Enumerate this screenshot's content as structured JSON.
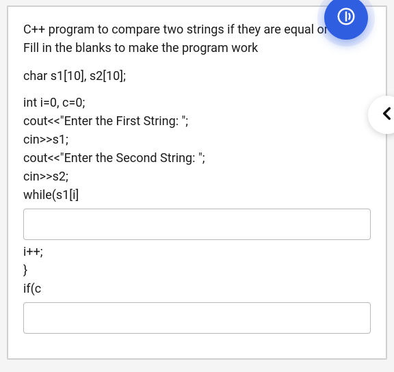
{
  "question": {
    "prompt": "C++ program to compare two strings if they are equal or not. Fill in the blanks to make the program work",
    "code": {
      "l1": "char s1[10], s2[10];",
      "l2": "int i=0, c=0;",
      "l3": "cout<<\"Enter the First String: \";",
      "l4": "cin>>s1;",
      "l5": "cout<<\"Enter the Second String: \";",
      "l6": "cin>>s2;",
      "l7": "while(s1[i]",
      "l8": "i++;",
      "l9": "}",
      "l10": "if(c"
    },
    "blanks": {
      "b1": "",
      "b2": ""
    }
  },
  "icons": {
    "audio": "audio-toggle-icon",
    "prev": "chevron-left-icon"
  }
}
